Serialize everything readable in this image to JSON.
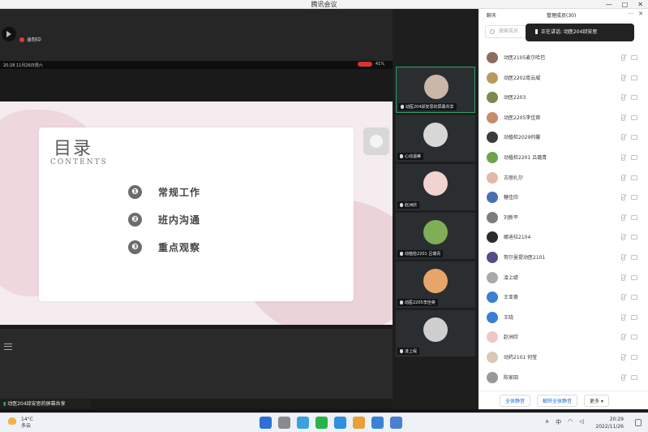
{
  "window": {
    "title": "腾讯会议"
  },
  "meeting": {
    "recording_label": "录制中"
  },
  "phone_status": {
    "time_date": "20:28  11月26日周六",
    "battery": "41%"
  },
  "slide": {
    "title": "目录",
    "subtitle": "CONTENTS",
    "items": [
      {
        "num": "❶",
        "label": "常规工作"
      },
      {
        "num": "❷",
        "label": "班内沟通"
      },
      {
        "num": "❸",
        "label": "重点观察"
      }
    ]
  },
  "share_tag": {
    "label": "动医204邱安思的屏幕共享"
  },
  "gallery": {
    "tiles": [
      {
        "name": "动医204邱安思的屏幕共享",
        "avatar_color": "#c9b7a8",
        "active": true
      },
      {
        "name": "心动温蒂",
        "avatar_color": "#d7d7d7",
        "active": false
      },
      {
        "name": "赵洲欣",
        "avatar_color": "#f1d3cf",
        "active": false
      },
      {
        "name": "动植检2201 吕璐青",
        "avatar_color": "#7fae57",
        "active": false
      },
      {
        "name": "动医2205李佳萸",
        "avatar_color": "#e7a56a",
        "active": false
      },
      {
        "name": "凌上缇",
        "avatar_color": "#cfcfcf",
        "active": false
      }
    ]
  },
  "panel": {
    "tab_chat": "聊天",
    "tab_members": "管理成员(30)",
    "search_placeholder": "搜索成员",
    "speaking_label": "正在讲话: 动医204邱安思",
    "members": [
      {
        "name": "动医2105麦尔哈巴",
        "color": "#8a6d5d"
      },
      {
        "name": "动医2202庞云威",
        "color": "#b59c5e"
      },
      {
        "name": "动医2203",
        "color": "#7a8a4e"
      },
      {
        "name": "动医2205李佳萸",
        "color": "#c78b6e"
      },
      {
        "name": "动植检2029何馨",
        "color": "#3b3b3b"
      },
      {
        "name": "动植检2201 吕璐青",
        "color": "#6fa24b"
      },
      {
        "name": "古丽扎尔",
        "color": "#e3b9a8"
      },
      {
        "name": "糖佳欣",
        "color": "#4a6fb0"
      },
      {
        "name": "刘新平",
        "color": "#7d7d7d"
      },
      {
        "name": "娜迪拉2104",
        "color": "#2c2c2c"
      },
      {
        "name": "努尔曼提动医2101",
        "color": "#5b4a8a"
      },
      {
        "name": "凌上缇",
        "color": "#a9a9a9"
      },
      {
        "name": "王亚豪",
        "color": "#3a7fd1"
      },
      {
        "name": "王晓",
        "color": "#3a7fd1"
      },
      {
        "name": "赵洲欣",
        "color": "#f0c7c2"
      },
      {
        "name": "动药2101 何莹",
        "color": "#d8c9b8"
      },
      {
        "name": "陈家田",
        "color": "#999999"
      }
    ],
    "btn_mute_all": "全体静音",
    "btn_unmute_all": "解除全体静音",
    "btn_more": "更多 ▾"
  },
  "taskbar": {
    "temp": "14°C",
    "weather": "多云",
    "ime": "中",
    "time": "20:29",
    "date": "2022/11/26",
    "app_colors": [
      "#2f6fd6",
      "#8a8a8a",
      "#3aa0e0",
      "#28b34a",
      "#2f8fe0",
      "#e9a03a",
      "#3a82d6",
      "#4a7fd1"
    ]
  }
}
